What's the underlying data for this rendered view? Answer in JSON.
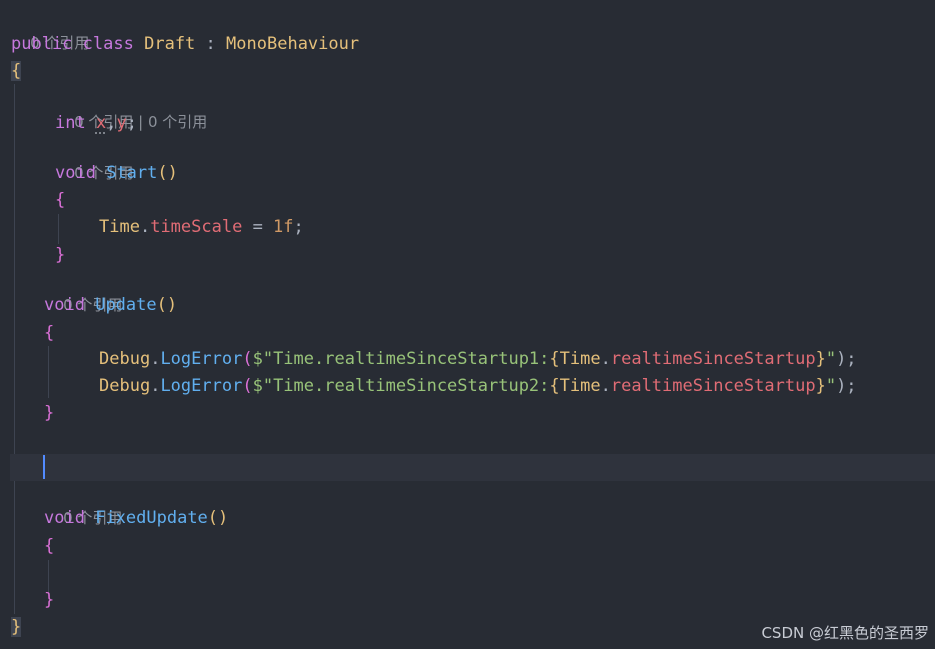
{
  "codelens": {
    "class_refs": "0 个引用",
    "field_refs": "0 个引用 | 0 个引用",
    "start_refs": "0 个引用",
    "update_refs": "0 个引用",
    "fixedupdate_refs": "0 个引用"
  },
  "code": {
    "kw_public": "public",
    "kw_class": "class",
    "class_name": "Draft",
    "colon": ":",
    "base_class": "MonoBehaviour",
    "open_brace": "{",
    "close_brace": "}",
    "open_paren_close": "()",
    "kw_int": "int",
    "field_x": "x",
    "comma": ",",
    "field_y": "y",
    "semicolon": ";",
    "kw_void": "void",
    "method_start": "Start",
    "method_update": "Update",
    "method_fixedupdate": "FixedUpdate",
    "type_time": "Time",
    "dot": ".",
    "prop_timescale": "timeScale",
    "assign": " = ",
    "num_1f": "1f",
    "type_debug": "Debug",
    "method_logerror": "LogError",
    "open_paren": "(",
    "interp_prefix": "$\"",
    "str_part1": "Time.realtimeSinceStartup1:",
    "str_part2": "Time.realtimeSinceStartup2:",
    "prop_rss": "realtimeSinceStartup",
    "quote": "\"",
    "call_end": ");"
  },
  "watermark": "CSDN @红黑色的圣西罗"
}
